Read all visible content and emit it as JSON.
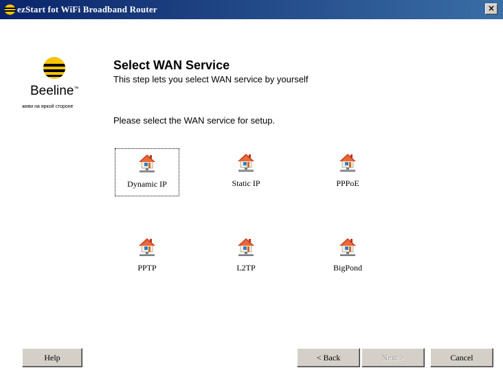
{
  "window": {
    "title": "ezStart fot WiFi Broadband Router",
    "close_label": "×",
    "colors": {
      "titlebar_start": "#0a246a",
      "titlebar_end": "#3a6ea5",
      "button_face": "#d4d0c8"
    }
  },
  "brand": {
    "name": "Beeline",
    "tm": "™",
    "tagline": "живи на яркой стороне",
    "colors": {
      "yellow": "#f5c400",
      "black": "#000000"
    }
  },
  "header": {
    "title": "Select WAN Service",
    "subtitle": "This step lets you select WAN service by yourself"
  },
  "instruction": "Please select the WAN service for setup.",
  "services": [
    {
      "label": "Dynamic IP",
      "icon": "network-house-icon",
      "focused": true
    },
    {
      "label": "Static IP",
      "icon": "network-house-icon",
      "focused": false
    },
    {
      "label": "PPPoE",
      "icon": "network-house-icon",
      "focused": false
    },
    {
      "label": "PPTP",
      "icon": "network-house-icon",
      "focused": false
    },
    {
      "label": "L2TP",
      "icon": "network-house-icon",
      "focused": false
    },
    {
      "label": "BigPond",
      "icon": "network-house-icon",
      "focused": false
    }
  ],
  "footer": {
    "help_label": "Help",
    "back_label": "< Back",
    "next_label": "Next >",
    "next_enabled": false,
    "cancel_label": "Cancel"
  }
}
